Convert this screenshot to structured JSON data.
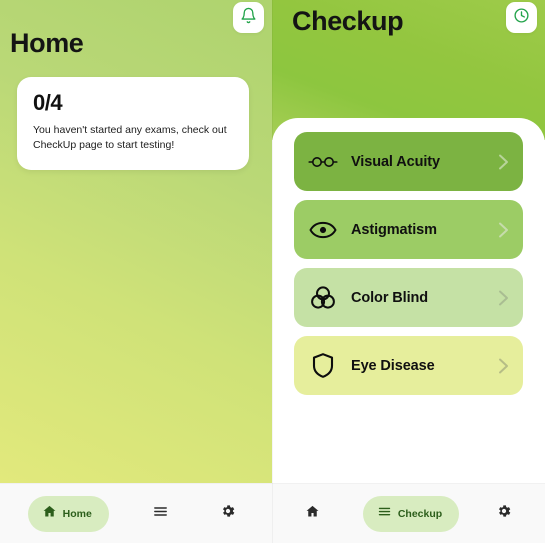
{
  "home": {
    "title": "Home",
    "notification_icon": "bell-icon",
    "status_card": {
      "count": "0/4",
      "message": "You haven't started any exams, check out CheckUp page to start testing!"
    },
    "bg_gradient_from": "#aed36e",
    "bg_gradient_to": "#e2e97c",
    "nav": [
      {
        "label": "Home",
        "icon": "home-icon",
        "active": true
      },
      {
        "label": "",
        "icon": "list-icon",
        "active": false
      },
      {
        "label": "",
        "icon": "gear-icon",
        "active": false
      }
    ]
  },
  "checkup": {
    "title": "Checkup",
    "history_icon": "clock-icon",
    "hero_gradient_from": "#9ecb4a",
    "hero_gradient_to": "#a6ce55",
    "tests": [
      {
        "label": "Visual Acuity",
        "icon": "glasses-icon",
        "color": "#7cb342",
        "chevron": "chevron-right-icon"
      },
      {
        "label": "Astigmatism",
        "icon": "eye-icon",
        "color": "#9ccc65",
        "chevron": "chevron-right-icon"
      },
      {
        "label": "Color Blind",
        "icon": "venn-circles-icon",
        "color": "#c5e1a5",
        "chevron": "chevron-right-icon"
      },
      {
        "label": "Eye Disease",
        "icon": "shield-icon",
        "color": "#e6ee9c",
        "chevron": "chevron-right-icon"
      }
    ],
    "nav": [
      {
        "label": "",
        "icon": "home-icon",
        "active": false
      },
      {
        "label": "Checkup",
        "icon": "list-icon",
        "active": true
      },
      {
        "label": "",
        "icon": "gear-icon",
        "active": false
      }
    ]
  }
}
